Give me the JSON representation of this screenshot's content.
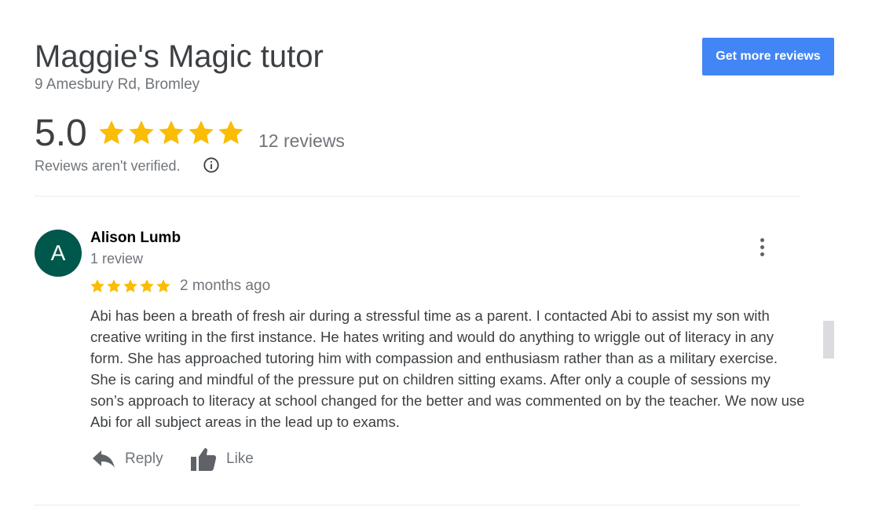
{
  "business": {
    "name": "Maggie's Magic tutor",
    "address": "9 Amesbury Rd, Bromley",
    "get_more_reviews_label": "Get more reviews"
  },
  "summary": {
    "rating": "5.0",
    "stars": 5,
    "review_count": "12 reviews",
    "verification_note": "Reviews aren't verified.",
    "info_icon": "info-icon"
  },
  "review": {
    "avatar_letter": "A",
    "avatar_color": "#00574b",
    "author": "Alison Lumb",
    "author_review_count": "1 review",
    "stars": 5,
    "date": "2 months ago",
    "text": "Abi has been a breath of fresh air during a stressful time as a parent. I contacted Abi to assist my son with creative writing in the first instance. He hates writing and would do anything to wriggle out of literacy in any form. She has approached tutoring him with compassion and enthusiasm rather than as a military exercise. She is caring and mindful of the pressure put on children sitting exams. After only a couple of sessions my son’s approach to literacy at school changed for the better and was commented on by the teacher. We now use Abi for all subject areas in the lead up to exams.",
    "more_icon": "more-vert-icon",
    "actions": {
      "reply_label": "Reply",
      "reply_icon": "reply-icon",
      "like_label": "Like",
      "like_icon": "thumbs-up-icon"
    }
  },
  "colors": {
    "accent": "#4285f4",
    "star": "#fbbc04",
    "muted_text": "#70757a",
    "icon": "#5f6368"
  }
}
